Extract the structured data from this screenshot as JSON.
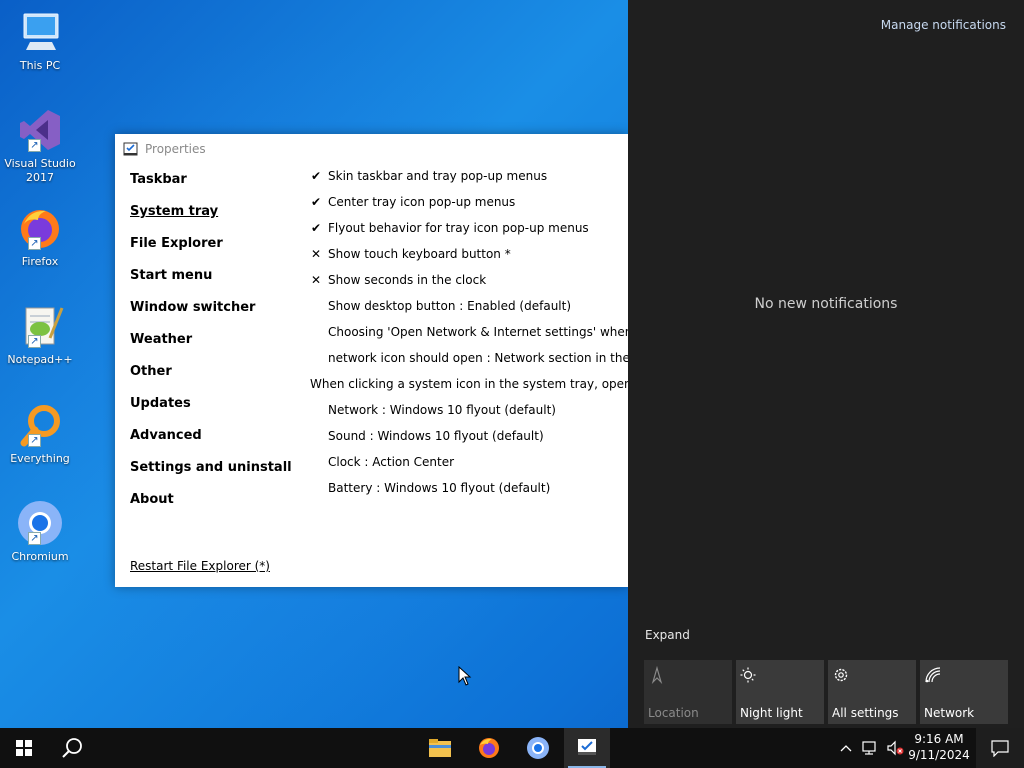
{
  "desktop": {
    "icons": [
      {
        "label": "This PC",
        "icon": "computer-icon"
      },
      {
        "label": "Visual Studio 2017",
        "icon": "visual-studio-icon"
      },
      {
        "label": "Firefox",
        "icon": "firefox-icon"
      },
      {
        "label": "Notepad++",
        "icon": "notepadpp-icon"
      },
      {
        "label": "Everything",
        "icon": "everything-search-icon"
      },
      {
        "label": "Chromium",
        "icon": "chromium-icon"
      }
    ]
  },
  "properties_window": {
    "title": "Properties",
    "nav": [
      {
        "label": "Taskbar",
        "active": false
      },
      {
        "label": "System tray",
        "active": true
      },
      {
        "label": "File Explorer",
        "active": false
      },
      {
        "label": "Start menu",
        "active": false
      },
      {
        "label": "Window switcher",
        "active": false
      },
      {
        "label": "Weather",
        "active": false
      },
      {
        "label": "Other",
        "active": false
      },
      {
        "label": "Updates",
        "active": false
      },
      {
        "label": "Advanced",
        "active": false
      },
      {
        "label": "Settings and uninstall",
        "active": false
      },
      {
        "label": "About",
        "active": false
      }
    ],
    "restart_link": "Restart File Explorer (*)",
    "options": [
      {
        "mark": "✔",
        "label": "Skin taskbar and tray pop-up menus"
      },
      {
        "mark": "✔",
        "label": "Center tray icon pop-up menus"
      },
      {
        "mark": "✔",
        "label": "Flyout behavior for tray icon pop-up menus"
      },
      {
        "mark": "✕",
        "label": "Show touch keyboard button *"
      },
      {
        "mark": "✕",
        "label": "Show seconds in the clock"
      },
      {
        "mark": "",
        "label": "Show desktop button : Enabled (default)"
      }
    ],
    "network_option": {
      "line1": "Choosing 'Open Network & Internet settings' when right",
      "line2": "network icon should open : Network section in the Settin"
    },
    "section_heading": "When clicking a system icon in the system tray, open:",
    "tray_options": [
      "Network : Windows 10 flyout (default)",
      "Sound : Windows 10 flyout (default)",
      "Clock : Action Center",
      "Battery : Windows 10 flyout (default)"
    ]
  },
  "action_center": {
    "manage_label": "Manage notifications",
    "empty_label": "No new notifications",
    "expand_label": "Expand",
    "quick_actions": [
      {
        "label": "Location",
        "icon": "location-icon",
        "enabled": false
      },
      {
        "label": "Night light",
        "icon": "night-light-icon",
        "enabled": true
      },
      {
        "label": "All settings",
        "icon": "gear-icon",
        "enabled": true
      },
      {
        "label": "Network",
        "icon": "network-icon",
        "enabled": true
      }
    ]
  },
  "taskbar": {
    "time": "9:16 AM",
    "date": "9/11/2024",
    "apps": [
      "file-explorer-icon",
      "firefox-icon",
      "chromium-icon",
      "properties-app-icon"
    ]
  },
  "colors": {
    "desktop_blue": "#0d71d6",
    "action_center_bg": "#1f1f1f",
    "taskbar_bg": "#101010",
    "tile_bg": "#3a3a3a"
  }
}
